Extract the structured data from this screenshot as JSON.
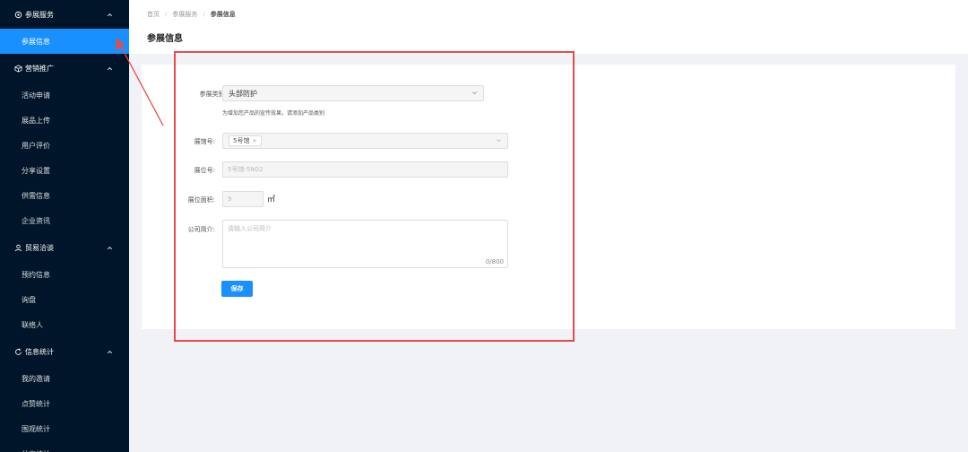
{
  "sidebar": {
    "groups": [
      {
        "icon": "gear-icon",
        "label": "参展服务",
        "items": [
          "参展信息"
        ]
      },
      {
        "icon": "box-icon",
        "label": "营销推广",
        "items": [
          "活动申请",
          "展品上传",
          "用户评价",
          "分享设置",
          "供需信息",
          "企业资讯"
        ]
      },
      {
        "icon": "user-icon",
        "label": "贸易洽谈",
        "items": [
          "预约信息",
          "询盘",
          "联络人"
        ]
      },
      {
        "icon": "refresh-icon",
        "label": "信息统计",
        "items": [
          "我的邀请",
          "点赞统计",
          "围观统计",
          "分享统计"
        ]
      }
    ],
    "active_item": "参展信息"
  },
  "breadcrumb": {
    "home": "首页",
    "section": "参展服务",
    "current": "参展信息"
  },
  "page_title": "参展信息",
  "form": {
    "category_label": "参展类别:",
    "category_value": "头部防护",
    "category_hint": "为增加您产品的宣传效果，请添加产品类别",
    "hall_label": "展馆号:",
    "hall_tag": "5号馆",
    "booth_label": "展位号:",
    "booth_value": "5号馆-5N02",
    "area_label": "展位面积:",
    "area_value": "9",
    "area_unit": "㎡",
    "intro_label": "公司简介:",
    "intro_placeholder": "请输入公司简介",
    "intro_counter": "0/800",
    "save_label": "保存"
  },
  "colors": {
    "sidebar_bg": "#001529",
    "accent": "#1890ff",
    "highlight": "#e84a4a"
  }
}
